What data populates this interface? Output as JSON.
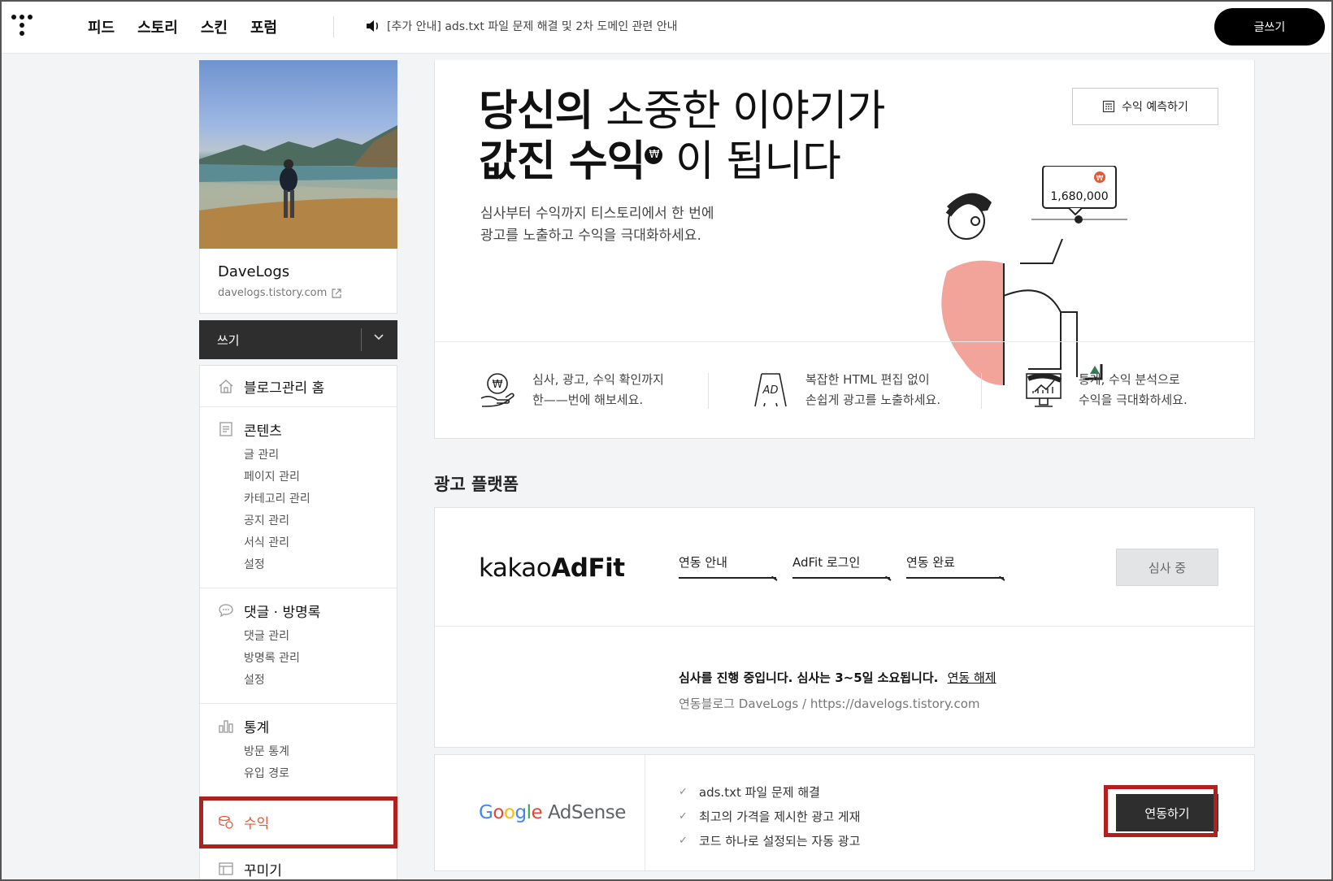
{
  "header": {
    "nav": [
      "피드",
      "스토리",
      "스킨",
      "포럼"
    ],
    "notice": "[추가 안내] ads.txt 파일 문제 해결 및 2차 도메인 관련 안내",
    "write_button": "글쓰기"
  },
  "sidebar": {
    "blog_name": "DaveLogs",
    "blog_url": "davelogs.tistory.com",
    "write_label": "쓰기",
    "groups": [
      {
        "label": "블로그관리 홈",
        "icon": "home-icon",
        "items": []
      },
      {
        "label": "콘텐츠",
        "icon": "document-icon",
        "items": [
          "글 관리",
          "페이지 관리",
          "카테고리 관리",
          "공지 관리",
          "서식 관리",
          "설정"
        ]
      },
      {
        "label": "댓글 · 방명록",
        "icon": "speech-bubble-icon",
        "items": [
          "댓글 관리",
          "방명록 관리",
          "설정"
        ]
      },
      {
        "label": "통계",
        "icon": "bar-chart-icon",
        "items": [
          "방문 통계",
          "유입 경로"
        ]
      }
    ],
    "revenue_label": "수익",
    "customize_label": "꾸미기"
  },
  "hero": {
    "title_line1_bold": "당신의",
    "title_line1_light": "소중한 이야기가",
    "title_line2_bold": "값진 수익",
    "title_line2_light": "이 됩니다",
    "won_symbol": "₩",
    "subtitle_line1": "심사부터 수익까지 티스토리에서 한 번에",
    "subtitle_line2": "광고를 노출하고 수익을 극대화하세요.",
    "predict_button": "수익 예측하기",
    "illustration_amount": "1,680,000",
    "features": [
      {
        "icon": "won-hand-icon",
        "line1": "심사, 광고, 수익 확인까지",
        "line2": "한——번에 해보세요."
      },
      {
        "icon": "ad-board-icon",
        "line1": "복잡한 HTML 편집 없이",
        "line2": "손쉽게 광고를 노출하세요."
      },
      {
        "icon": "monitor-chart-icon",
        "line1": "통계, 수익 분석으로",
        "line2": "수익을 극대화하세요."
      }
    ]
  },
  "platforms": {
    "section_title": "광고 플랫폼",
    "adfit": {
      "logo_light": "kakao",
      "logo_bold": "AdFit",
      "steps": [
        "연동 안내",
        "AdFit 로그인",
        "연동 완료"
      ],
      "status_button": "심사 중",
      "status_message": "심사를 진행 중입니다. 심사는 3~5일 소요됩니다.",
      "unlink_label": "연동 해제",
      "linked_blog": "연동블로그 DaveLogs / https://davelogs.tistory.com"
    },
    "adsense": {
      "logo_google": [
        "G",
        "o",
        "o",
        "g",
        "l",
        "e"
      ],
      "logo_product": "AdSense",
      "benefits": [
        "ads.txt 파일 문제 해결",
        "최고의 가격을 제시한 광고 게재",
        "코드 하나로 설정되는 자동 광고"
      ],
      "link_button": "연동하기"
    }
  },
  "colors": {
    "accent_red": "#e05a3a",
    "highlight_border": "#b0201c",
    "google_blue": "#4285F4",
    "google_red": "#EA4335",
    "google_yellow": "#FBBC05",
    "google_green": "#34A853"
  }
}
